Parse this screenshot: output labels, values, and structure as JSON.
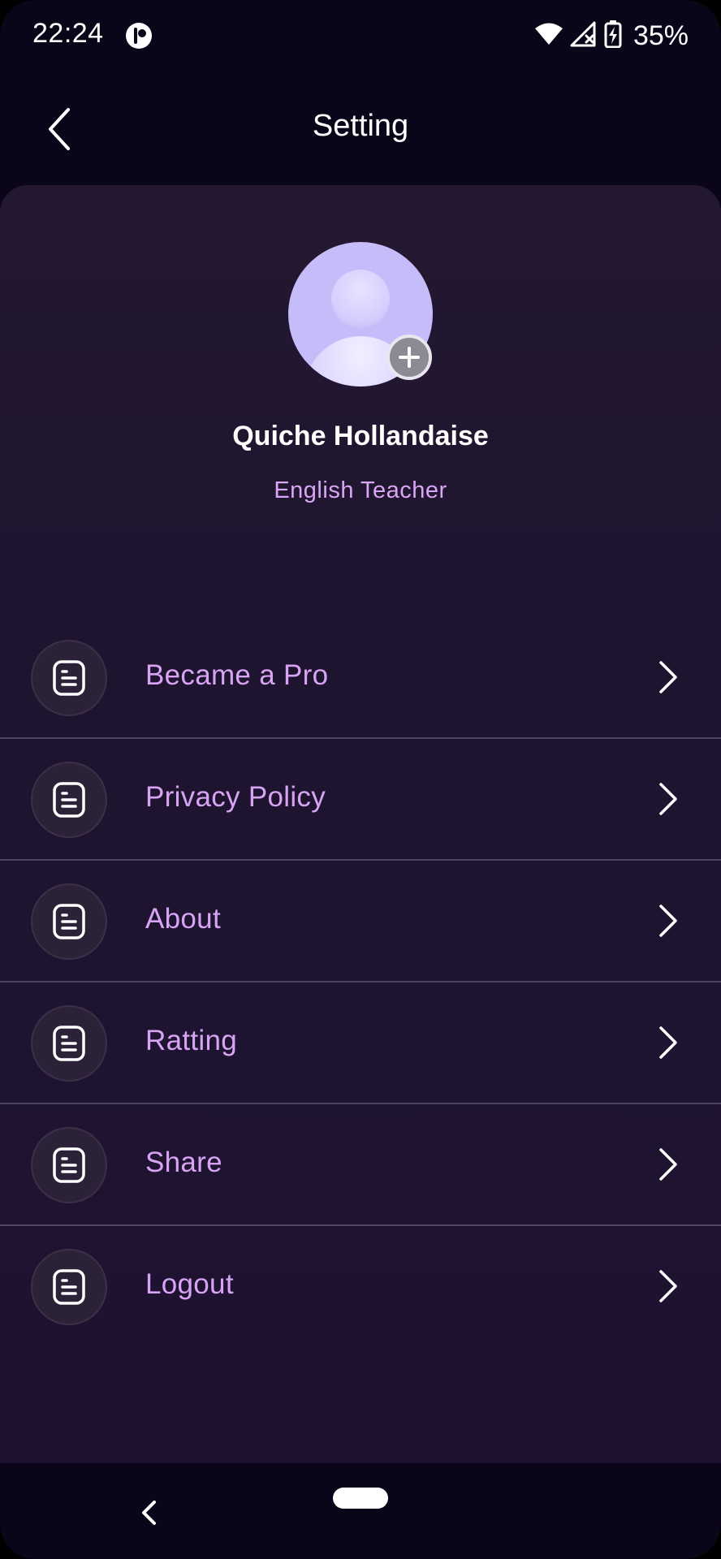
{
  "status_bar": {
    "time": "22:24",
    "battery_percent": "35%",
    "icons": [
      "app-notification-icon",
      "wifi-icon",
      "signal-icon",
      "battery-icon"
    ]
  },
  "header": {
    "title": "Setting",
    "back_icon": "chevron-left-icon"
  },
  "profile": {
    "name": "Quiche Hollandaise",
    "role": "English Teacher",
    "avatar_icon": "user-placeholder-icon",
    "add_icon": "plus-icon"
  },
  "menu": {
    "items": [
      {
        "label": "Became a Pro"
      },
      {
        "label": "Privacy Policy"
      },
      {
        "label": "About"
      },
      {
        "label": "Ratting"
      },
      {
        "label": "Share"
      },
      {
        "label": "Logout"
      }
    ],
    "item_icon": "document-icon",
    "chevron_icon": "chevron-right-icon"
  },
  "colors": {
    "background": "#0b0519",
    "panel": "#1f1430",
    "accent_text": "#d7a4f3",
    "avatar": "#c6bcf9",
    "divider": "#4e4560"
  }
}
